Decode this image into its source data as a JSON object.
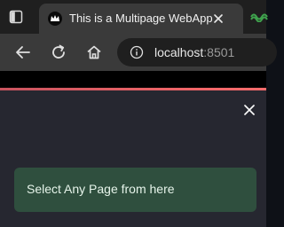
{
  "browser": {
    "tab": {
      "title": "This is a Multipage WebApp"
    },
    "address_bar": {
      "host": "localhost",
      "port": ":8501"
    }
  },
  "sidebar": {
    "alert_text": "Select Any Page from here"
  }
}
